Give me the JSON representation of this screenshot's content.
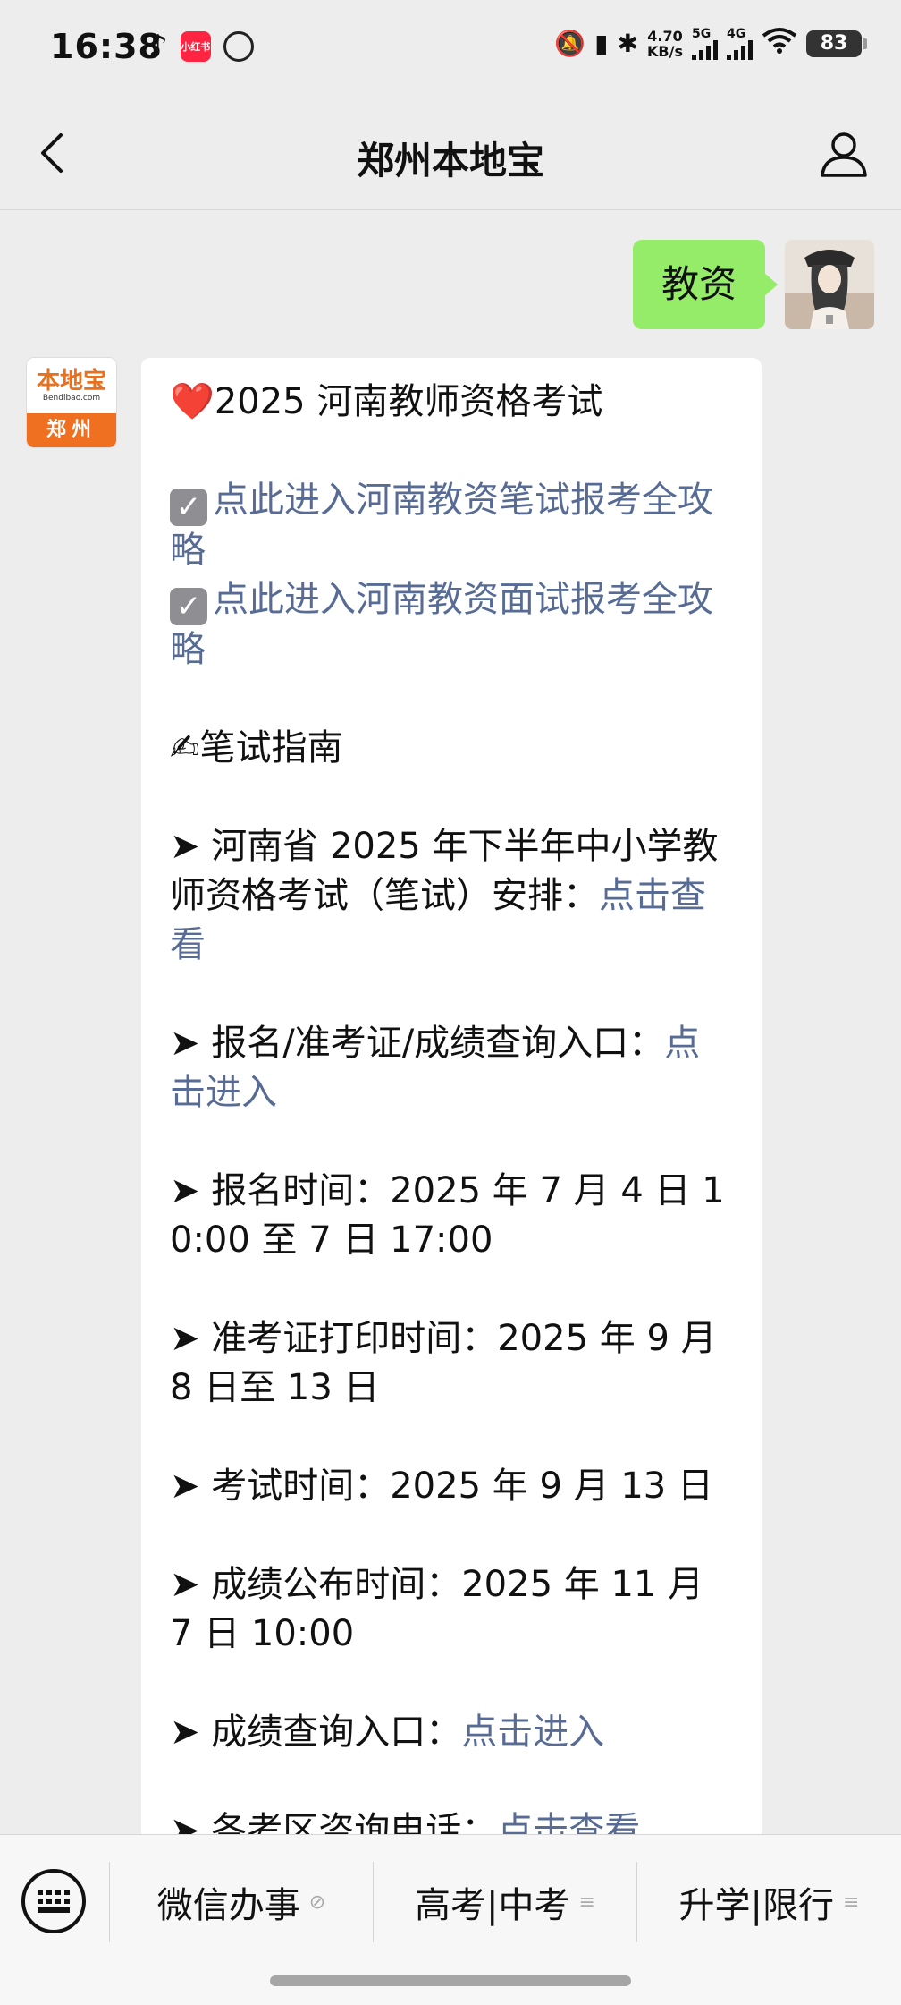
{
  "status": {
    "time": "16:38",
    "app_icons": [
      "tiktok-icon",
      "xiaohongshu-icon",
      "weibo-icon"
    ],
    "xhs_text": "小红书",
    "netspeed_value": "4.70",
    "netspeed_unit": "KB/s",
    "signal1": "5G",
    "signal2": "4G",
    "battery": "83"
  },
  "nav": {
    "title": "郑州本地宝"
  },
  "outgoing": {
    "text": "教资"
  },
  "bot_avatar": {
    "logo": "本地宝",
    "url": "Bendibao.com",
    "city": "郑州"
  },
  "message": {
    "title": "2025 河南教师资格考试",
    "link1": "点此进入河南教资笔试报考全攻略",
    "link2": "点此进入河南教资面试报考全攻略",
    "guide": "✍笔试指南",
    "item1_text": "➤ 河南省 2025 年下半年中小学教师资格考试（笔试）安排：",
    "item1_link": "点击查看",
    "item2_text": "➤ 报名/准考证/成绩查询入口：",
    "item2_link": "点击进入",
    "item3_text": "➤ 报名时间：2025 年 7 月 4 日 10:00 至 7 日 17:00",
    "item4_text": "➤ 准考证打印时间：2025 年 9 月 8 日至 13 日",
    "item5_text": "➤ 考试时间：2025 年 9 月 13 日",
    "item6_text": "➤ 成绩公布时间：2025 年 11 月 7 日 10:00",
    "item7_text": "➤ 成绩查询入口：",
    "item7_link": "点击进入",
    "item8_text": "➤ 各考区咨询电话：",
    "item8_link": "点击查看"
  },
  "menu": {
    "item1": "微信办事",
    "item2": "高考|中考",
    "item3": "升学|限行",
    "mark_link": "⊘",
    "mark_list": "≡"
  },
  "colors": {
    "link": "#576b95",
    "outgoing_bubble": "#95ec69",
    "brand_orange": "#ee7020"
  }
}
